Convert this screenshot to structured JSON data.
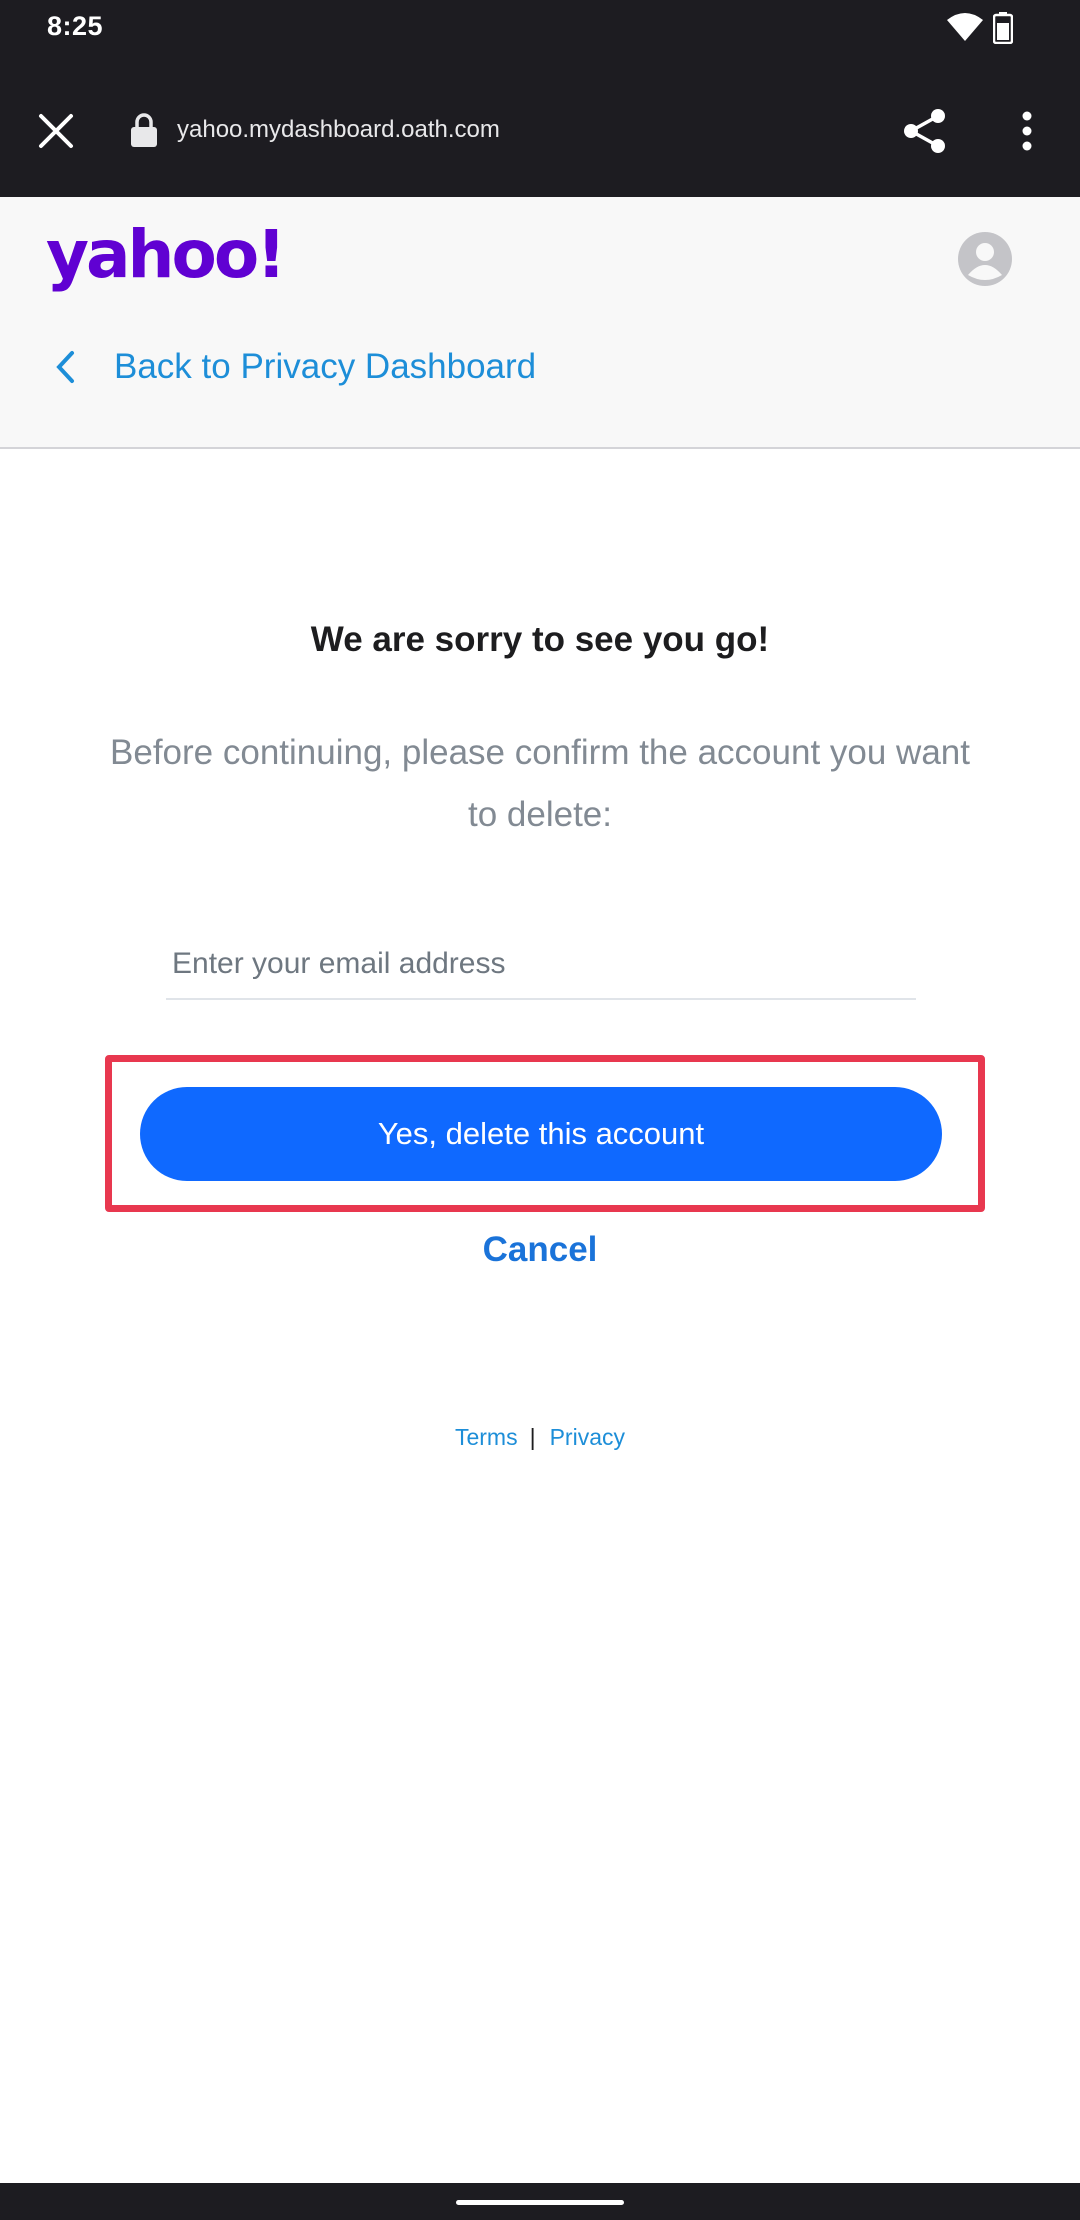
{
  "status_bar": {
    "time": "8:25",
    "icons": [
      "wifi-icon",
      "battery-icon"
    ]
  },
  "browser": {
    "url": "yahoo.mydashboard.oath.com",
    "icons": [
      "close-icon",
      "lock-icon",
      "share-icon",
      "more-vert-icon"
    ]
  },
  "header": {
    "logo_text": "yahoo!",
    "logo_color": "#6001d2",
    "back_link_label": "Back to Privacy Dashboard"
  },
  "main": {
    "title": "We are sorry to see you go!",
    "description": "Before continuing, please confirm the account you want to delete:",
    "email_input": {
      "value": "",
      "placeholder": "Enter your email address"
    },
    "delete_button_label": "Yes, delete this account",
    "cancel_label": "Cancel"
  },
  "footer": {
    "terms_label": "Terms",
    "separator": "|",
    "privacy_label": "Privacy"
  },
  "colors": {
    "accent": "#0f69ff",
    "link": "#1d8ed8",
    "highlight": "#e8384f"
  }
}
